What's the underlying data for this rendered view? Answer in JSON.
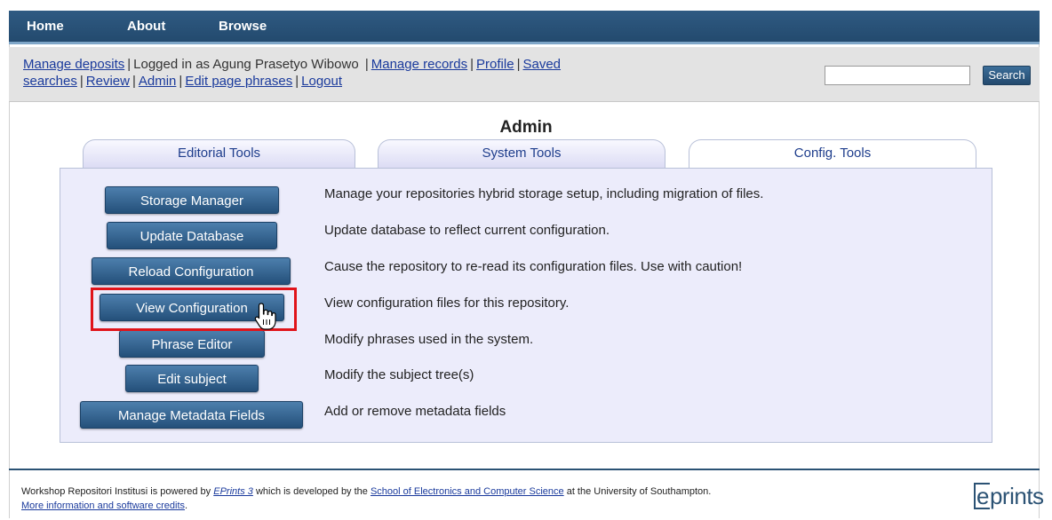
{
  "topnav": {
    "home": "Home",
    "about": "About",
    "browse": "Browse"
  },
  "login": {
    "manage_deposits": "Manage deposits",
    "logged_in_as": "Logged in as Agung Prasetyo Wibowo",
    "manage_records": "Manage records",
    "profile": "Profile",
    "saved_searches_1": "Saved",
    "saved_searches_2": "searches",
    "review": "Review",
    "admin": "Admin",
    "edit_page_phrases": "Edit page phrases",
    "logout": "Logout",
    "separator": "|"
  },
  "search": {
    "value": "",
    "button": "Search"
  },
  "page": {
    "title": "Admin"
  },
  "tabs": [
    {
      "label": "Editorial Tools",
      "active": false
    },
    {
      "label": "System Tools",
      "active": false
    },
    {
      "label": "Config. Tools",
      "active": true
    }
  ],
  "tools": [
    {
      "button": "Storage Manager",
      "description": "Manage your repositories hybrid storage setup, including migration of files."
    },
    {
      "button": "Update Database",
      "description": "Update database to reflect current configuration."
    },
    {
      "button": "Reload Configuration",
      "description": "Cause the repository to re-read its configuration files. Use with caution!"
    },
    {
      "button": "View Configuration",
      "description": "View configuration files for this repository."
    },
    {
      "button": "Phrase Editor",
      "description": "Modify phrases used in the system."
    },
    {
      "button": "Edit subject",
      "description": "Modify the subject tree(s)"
    },
    {
      "button": "Manage Metadata Fields",
      "description": "Add or remove metadata fields"
    }
  ],
  "footer": {
    "text_1": "Workshop Repositori Institusi is powered by",
    "eprints_link": "EPrints 3",
    "text_2": "which is developed by the",
    "school_link": "School of Electronics and Computer Science",
    "text_3": "at the University of Southampton.",
    "more_info": "More information and software credits",
    "period": "."
  },
  "logo": {
    "e": "e",
    "rest": "prints"
  },
  "colors": {
    "nav": "#234a6e",
    "highlight": "#e0141a",
    "button": "#24507a",
    "panel": "#ececfb"
  }
}
